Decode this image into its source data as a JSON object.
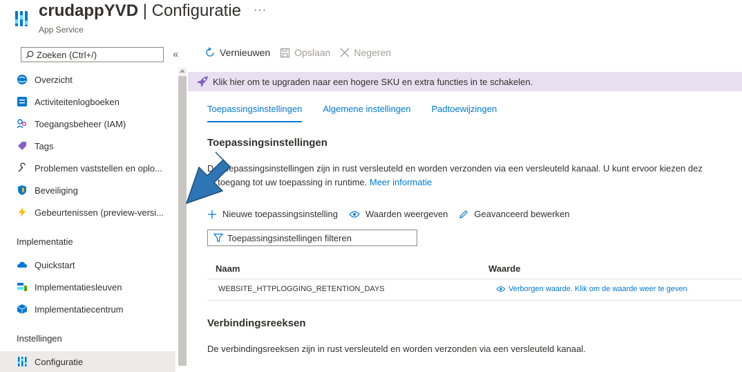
{
  "header": {
    "app_name": "crudappYVD",
    "separator": " | ",
    "page": "Configuratie",
    "more": "···",
    "subtitle": "App Service"
  },
  "sidebar": {
    "search_placeholder": "Zoeken (Ctrl+/)",
    "collapse": "«",
    "items": [
      {
        "label": "Overzicht",
        "icon": "globe-icon"
      },
      {
        "label": "Activiteitenlogboeken",
        "icon": "log-icon"
      },
      {
        "label": "Toegangsbeheer (IAM)",
        "icon": "people-icon"
      },
      {
        "label": "Tags",
        "icon": "tag-icon"
      },
      {
        "label": "Problemen vaststellen en oplo...",
        "icon": "wrench-icon"
      },
      {
        "label": "Beveiliging",
        "icon": "shield-icon"
      },
      {
        "label": "Gebeurtenissen (preview-versi...",
        "icon": "lightning-icon"
      }
    ],
    "section_implementatie": "Implementatie",
    "impl_items": [
      {
        "label": "Quickstart",
        "icon": "cloud-icon"
      },
      {
        "label": "Implementatiesleuven",
        "icon": "slots-icon"
      },
      {
        "label": "Implementatiecentrum",
        "icon": "cube-icon"
      }
    ],
    "section_instellingen": "Instellingen",
    "settings_items": [
      {
        "label": "Configuratie",
        "icon": "config-icon"
      }
    ]
  },
  "toolbar": {
    "refresh": "Vernieuwen",
    "save": "Opslaan",
    "discard": "Negeren"
  },
  "banner": {
    "text": "Klik hier om te upgraden naar een hogere SKU en extra functies in te schakelen."
  },
  "tabs": [
    {
      "label": "Toepassingsinstellingen",
      "active": true
    },
    {
      "label": "Algemene instellingen",
      "active": false
    },
    {
      "label": "Padtoewijzingen",
      "active": false
    }
  ],
  "app_settings": {
    "title": "Toepassingsinstellingen",
    "desc_line1": "De toepassingsinstellingen zijn in rust versleuteld en worden verzonden via een versleuteld kanaal. U kunt ervoor kiezen dez",
    "desc_line2_pre": "er toegang tot uw toepassing in runtime. ",
    "desc_link": "Meer informatie",
    "new_setting": "Nieuwe toepassingsinstelling",
    "show_values": "Waarden weergeven",
    "advanced_edit": "Geavanceerd bewerken",
    "filter_placeholder": "Toepassingsinstellingen filteren",
    "columns": [
      "Naam",
      "Waarde"
    ],
    "rows": [
      {
        "name": "WEBSITE_HTTPLOGGING_RETENTION_DAYS",
        "value": "Verborgen waarde. Klik om de waarde weer te geven"
      }
    ]
  },
  "connection_strings": {
    "title": "Verbindingsreeksen",
    "desc": "De verbindingsreeksen zijn in rust versleuteld en worden verzonden via een versleuteld kanaal."
  },
  "colors": {
    "accent": "#0078d4",
    "banner": "#e8dff0",
    "arrow": "#2e75b6"
  }
}
